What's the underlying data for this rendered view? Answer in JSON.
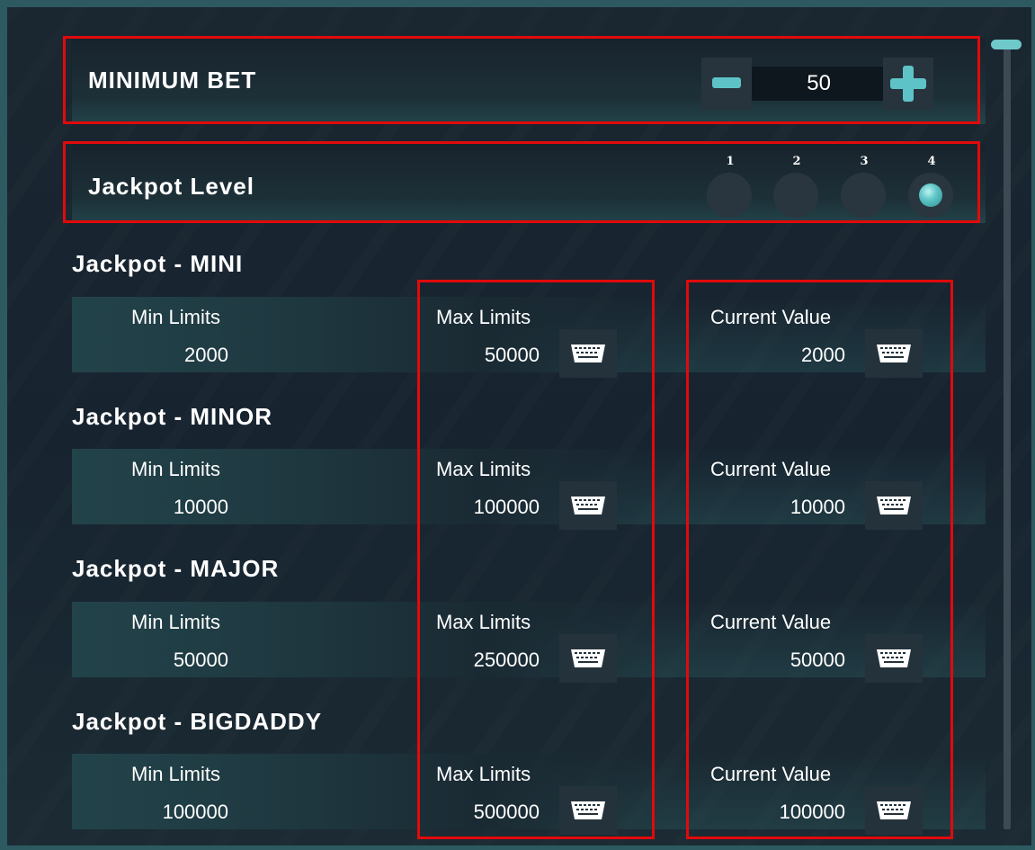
{
  "minimum_bet": {
    "label": "MINIMUM BET",
    "value": "50",
    "decrement_icon": "minus-icon",
    "increment_icon": "plus-icon"
  },
  "jackpot_level": {
    "label": "Jackpot Level",
    "levels": [
      "1",
      "2",
      "3",
      "4"
    ],
    "selected": "4"
  },
  "jackpots": [
    {
      "title": "Jackpot - MINI",
      "min_label": "Min Limits",
      "min_value": "2000",
      "max_label": "Max Limits",
      "max_value": "50000",
      "current_label": "Current Value",
      "current_value": "2000"
    },
    {
      "title": "Jackpot - MINOR",
      "min_label": "Min Limits",
      "min_value": "10000",
      "max_label": "Max Limits",
      "max_value": "100000",
      "current_label": "Current Value",
      "current_value": "10000"
    },
    {
      "title": "Jackpot - MAJOR",
      "min_label": "Min Limits",
      "min_value": "50000",
      "max_label": "Max Limits",
      "max_value": "250000",
      "current_label": "Current Value",
      "current_value": "50000"
    },
    {
      "title": "Jackpot - BIGDADDY",
      "min_label": "Min Limits",
      "min_value": "100000",
      "max_label": "Max Limits",
      "max_value": "500000",
      "current_label": "Current Value",
      "current_value": "100000"
    }
  ],
  "icons": {
    "edit": "keyboard-icon"
  },
  "colors": {
    "accent": "#5ec3c6",
    "highlight": "#e10a0a",
    "background": "#172430"
  }
}
